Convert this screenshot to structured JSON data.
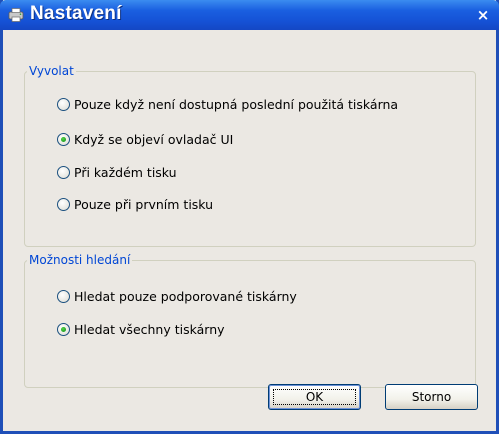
{
  "window": {
    "title": "Nastavení",
    "icon": "printer-app-icon",
    "close_glyph": "×"
  },
  "groups": {
    "vyvolat": {
      "legend": "Vyvolat",
      "options": [
        {
          "label": "Pouze když není dostupná poslední použitá tiskárna",
          "checked": false
        },
        {
          "label": "Když se objeví ovladač UI",
          "checked": true
        },
        {
          "label": "Při každém tisku",
          "checked": false
        },
        {
          "label": "Pouze při prvním tisku",
          "checked": false
        }
      ]
    },
    "moznosti": {
      "legend": "Možnosti hledání",
      "options": [
        {
          "label": "Hledat pouze podporované tiskárny",
          "checked": false
        },
        {
          "label": "Hledat všechny tiskárny",
          "checked": true
        }
      ]
    }
  },
  "buttons": {
    "ok_label": "OK",
    "cancel_label": "Storno"
  },
  "colors": {
    "titlebar": "#1a5fe0",
    "legend": "#0046d5",
    "radio_checked": "#21a121"
  }
}
